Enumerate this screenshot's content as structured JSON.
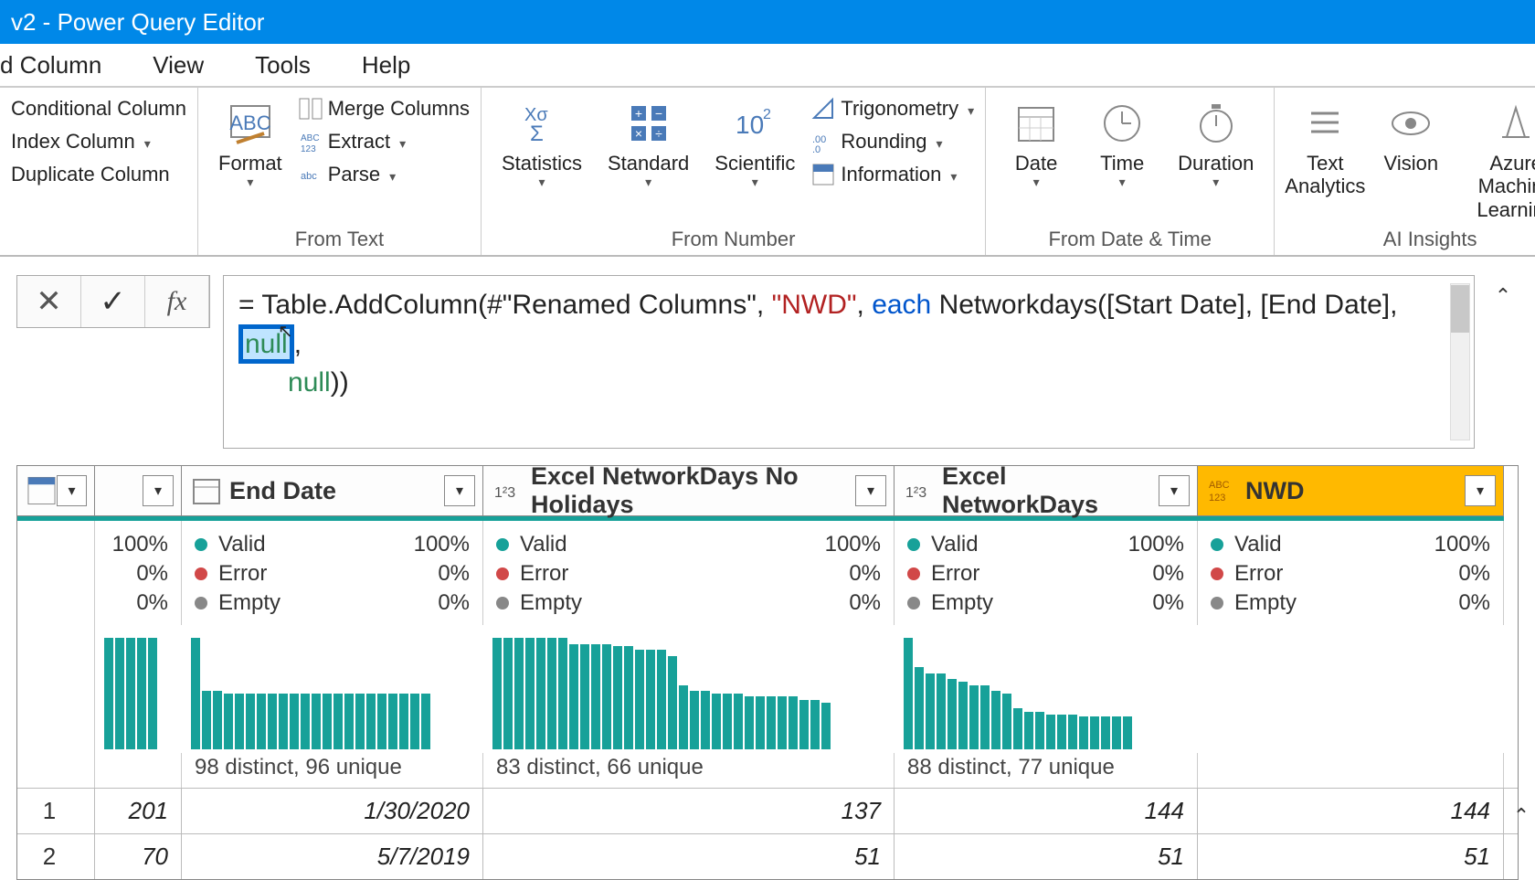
{
  "title": "v2 - Power Query Editor",
  "tabs": {
    "addcol": "d Column",
    "view": "View",
    "tools": "Tools",
    "help": "Help"
  },
  "ribbon": {
    "conditional": "Conditional Column",
    "index": "Index Column",
    "duplicate": "Duplicate Column",
    "format": "Format",
    "merge": "Merge Columns",
    "extract": "Extract",
    "parse": "Parse",
    "fromtext": "From Text",
    "statistics": "Statistics",
    "standard": "Standard",
    "scientific": "Scientific",
    "trig": "Trigonometry",
    "rounding": "Rounding",
    "information": "Information",
    "fromnumber": "From Number",
    "date": "Date",
    "time": "Time",
    "duration": "Duration",
    "fromdatetime": "From Date & Time",
    "textanalytics": "Text\nAnalytics",
    "vision": "Vision",
    "aml": "Azure Machine\nLearning",
    "aiinsights": "AI Insights"
  },
  "formula": {
    "part1": "= Table.AddColumn(#\"Renamed Columns\", ",
    "str": "\"NWD\"",
    "part2": ", ",
    "each": "each",
    "part3": " Networkdays([Start Date], [End Date], ",
    "hlnull": "null",
    "part4": ", ",
    "null2": "null",
    "part5": "))"
  },
  "columns": {
    "c2": "End Date",
    "c3": "Excel NetworkDays No Holidays",
    "c4": "Excel NetworkDays",
    "c5": "NWD"
  },
  "quality": {
    "valid": "Valid",
    "error": "Error",
    "empty": "Empty",
    "p100": "100%",
    "p0": "0%"
  },
  "distinct": {
    "c2": "98 distinct, 96 unique",
    "c3": "83 distinct, 66 unique",
    "c4": "88 distinct, 77 unique"
  },
  "rows": {
    "r1": {
      "n": "1",
      "c1": "201",
      "c2": "1/30/2020",
      "c3": "137",
      "c4": "144",
      "c5": "144"
    },
    "r2": {
      "n": "2",
      "c1": "70",
      "c2": "5/7/2019",
      "c3": "51",
      "c4": "51",
      "c5": "51"
    }
  }
}
